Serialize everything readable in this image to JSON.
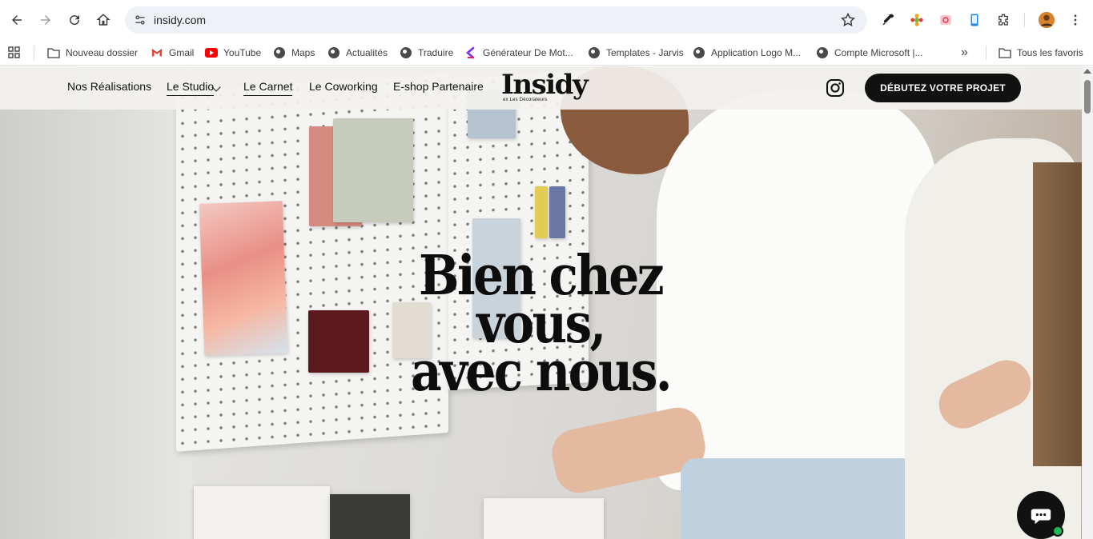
{
  "browser": {
    "url": "insidy.com",
    "bookmarks": [
      {
        "label": "Nouveau dossier",
        "icon": "folder-icon"
      },
      {
        "label": "Gmail",
        "icon": "gmail-icon"
      },
      {
        "label": "YouTube",
        "icon": "youtube-icon"
      },
      {
        "label": "Maps",
        "icon": "globe-icon"
      },
      {
        "label": "Actualités",
        "icon": "globe-icon"
      },
      {
        "label": "Traduire",
        "icon": "globe-icon"
      },
      {
        "label": "Générateur De Mot...",
        "icon": "k-logo-icon"
      },
      {
        "label": "Templates - Jarvis",
        "icon": "globe-icon"
      },
      {
        "label": "Application Logo M...",
        "icon": "globe-icon"
      },
      {
        "label": "Compte Microsoft |...",
        "icon": "globe-icon"
      }
    ],
    "more_bookmarks": "»",
    "all_bookmarks": "Tous les favoris"
  },
  "site": {
    "nav": [
      {
        "label": "Nos Réalisations"
      },
      {
        "label": "Le Studio"
      },
      {
        "label": "Le Carnet"
      },
      {
        "label": "Le Coworking"
      },
      {
        "label": "E-shop Partenaire"
      }
    ],
    "logo": "Insidy",
    "logo_sub": "ex Les Décorateurs",
    "cta": "DÉBUTEZ VOTRE PROJET",
    "headline_line1": "Bien chez vous,",
    "headline_line2": "avec nous."
  },
  "colors": {
    "header_bg": "#f2f1ee",
    "cta_bg": "#111111",
    "chat_status": "#1db954"
  }
}
